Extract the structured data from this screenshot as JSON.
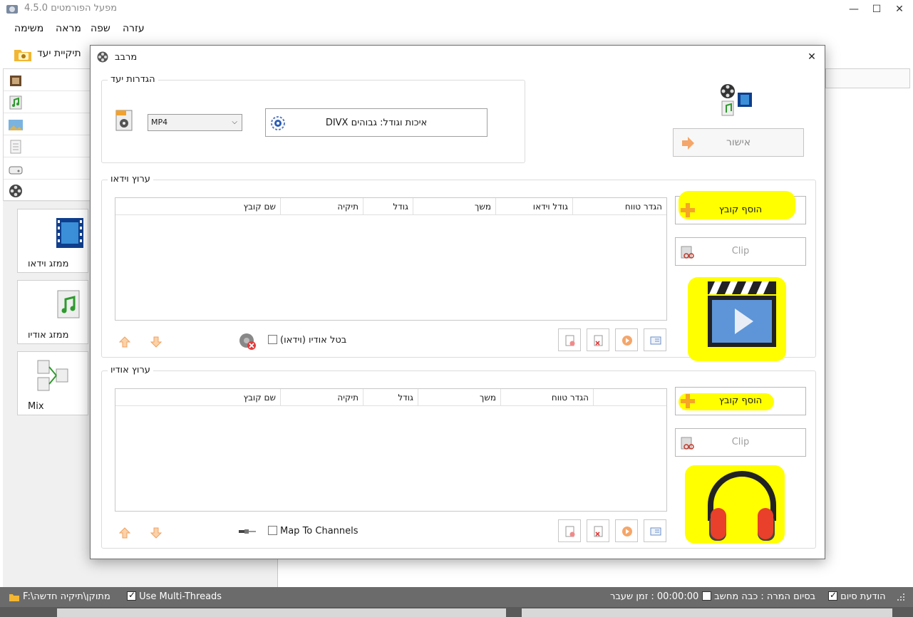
{
  "window": {
    "title": "מפעל הפורמטים 4.5.0",
    "minimize": "—",
    "maximize": "☐",
    "close": "✕"
  },
  "menu": [
    "משימה",
    "מראה",
    "שפה",
    "עזרה"
  ],
  "toolbar": {
    "dest_folder": "תיקיית יעד"
  },
  "tiles": [
    {
      "label": "ממזג וידאו"
    },
    {
      "label": "ממזג אודיו"
    },
    {
      "label": "Mix"
    }
  ],
  "statusbar": {
    "folder_path": "F:\\מתוקן\\תיקיה חדשה",
    "multi_threads": "Use Multi-Threads",
    "elapsed": "00:00:00 : זמן שעבר",
    "on_finish": "בסיום המרה : כבה מחשב",
    "notify": "הודעת סיום"
  },
  "dialog": {
    "title": "מרבב",
    "close": "✕",
    "target": {
      "legend": "הגדרות יעד",
      "format": "MP4",
      "quality": "איכות וגודל: גבוהים DIVX"
    },
    "ok": "אישור",
    "video": {
      "legend": "ערוץ וידאו",
      "columns": [
        "שם קובץ",
        "תיקיה",
        "גודל",
        "משך",
        "גודל וידאו",
        "הגדר טווח"
      ],
      "add_file": "הוסף קובץ",
      "clip": "Clip",
      "option": "בטל אודיו (וידאו)"
    },
    "audio": {
      "legend": "ערוץ אודיו",
      "columns": [
        "שם קובץ",
        "תיקיה",
        "גודל",
        "משך",
        "הגדר טווח",
        ""
      ],
      "add_file": "הוסף קובץ",
      "clip": "Clip",
      "option": "Map To Channels"
    }
  },
  "colors": {
    "highlight": "#ffff00",
    "accent_orange": "#f5a623"
  }
}
